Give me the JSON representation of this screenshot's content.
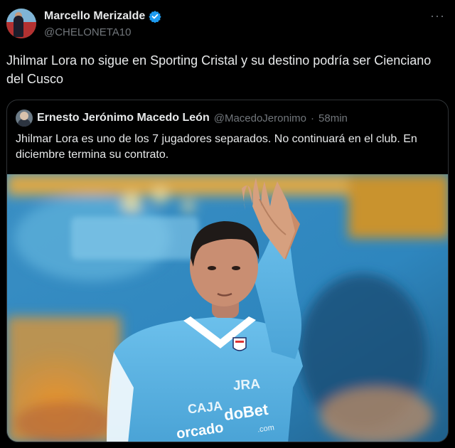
{
  "author": {
    "display_name": "Marcello Merizalde",
    "handle": "@CHELONETA10",
    "verified": true
  },
  "more_label": "···",
  "tweet_text": "Jhilmar Lora no sigue en Sporting Cristal y su destino podría ser Cienciano del Cusco",
  "quoted": {
    "display_name": "Ernesto Jerónimo Macedo León",
    "handle": "@MacedoJeronimo",
    "separator": "·",
    "time": "58min",
    "text": "Jhilmar Lora es uno de los 7 jugadores separados. No continuará en el club. En diciembre termina su contrato.",
    "photo": {
      "jersey_text_1": "JRA",
      "jersey_text_2": "CAJA",
      "jersey_text_3": "doBet",
      "jersey_text_4": ".com",
      "jersey_text_5": "orcado"
    }
  },
  "colors": {
    "background": "#000000",
    "text": "#e7e9ea",
    "muted": "#71767b",
    "border": "#2f3336",
    "verified": "#1d9bf0",
    "jersey": "#5fb3e0"
  }
}
